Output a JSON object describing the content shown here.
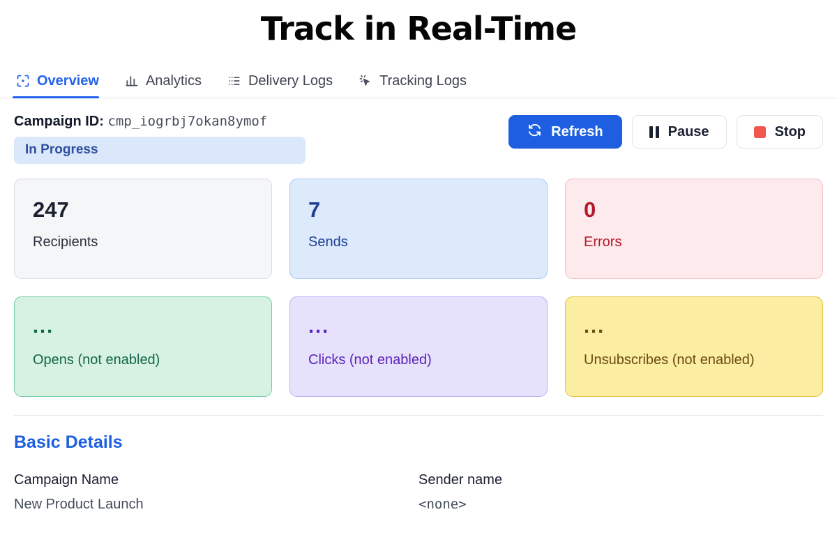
{
  "page": {
    "title": "Track in Real-Time"
  },
  "tabs": [
    {
      "label": "Overview",
      "icon": "scan-focus-icon",
      "active": true
    },
    {
      "label": "Analytics",
      "icon": "bar-chart-icon",
      "active": false
    },
    {
      "label": "Delivery Logs",
      "icon": "list-icon",
      "active": false
    },
    {
      "label": "Tracking Logs",
      "icon": "cursor-click-icon",
      "active": false
    }
  ],
  "campaign": {
    "id_label": "Campaign ID:",
    "id_value": "cmp_iogrbj7okan8ymof",
    "status": "In Progress"
  },
  "actions": [
    {
      "label": "Refresh",
      "icon": "refresh-icon",
      "style": "primary"
    },
    {
      "label": "Pause",
      "icon": "pause-icon",
      "style": "default"
    },
    {
      "label": "Stop",
      "icon": "stop-icon",
      "style": "default"
    }
  ],
  "stats": [
    {
      "value": "247",
      "label": "Recipients",
      "theme": "gray"
    },
    {
      "value": "7",
      "label": "Sends",
      "theme": "blue"
    },
    {
      "value": "0",
      "label": "Errors",
      "theme": "red"
    },
    {
      "value": "...",
      "label": "Opens (not enabled)",
      "theme": "green"
    },
    {
      "value": "...",
      "label": "Clicks (not enabled)",
      "theme": "purple"
    },
    {
      "value": "...",
      "label": "Unsubscribes (not enabled)",
      "theme": "yellow"
    }
  ],
  "basic_details": {
    "title": "Basic Details",
    "fields": [
      {
        "key": "Campaign Name",
        "value": "New Product Launch",
        "mono": false
      },
      {
        "key": "Sender name",
        "value": "<none>",
        "mono": true
      }
    ]
  },
  "colors": {
    "accent_blue": "#1d5fe0",
    "tab_active": "#2563eb",
    "status_badge_bg": "#dbe8fb",
    "status_badge_text": "#2f4f9e",
    "stop_red": "#f2564f"
  }
}
